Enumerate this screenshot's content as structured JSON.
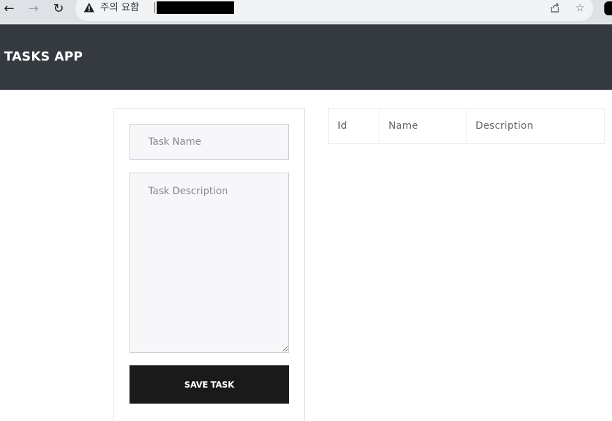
{
  "browser": {
    "security_warning": "주의 요함"
  },
  "app": {
    "brand": "TASKS APP"
  },
  "form": {
    "task_name_placeholder": "Task Name",
    "task_description_placeholder": "Task Description",
    "save_label": "SAVE TASK"
  },
  "table": {
    "columns": [
      "Id",
      "Name",
      "Description"
    ],
    "rows": []
  },
  "colors": {
    "header_bg": "#343a40",
    "button_bg": "#1a1a1a"
  }
}
